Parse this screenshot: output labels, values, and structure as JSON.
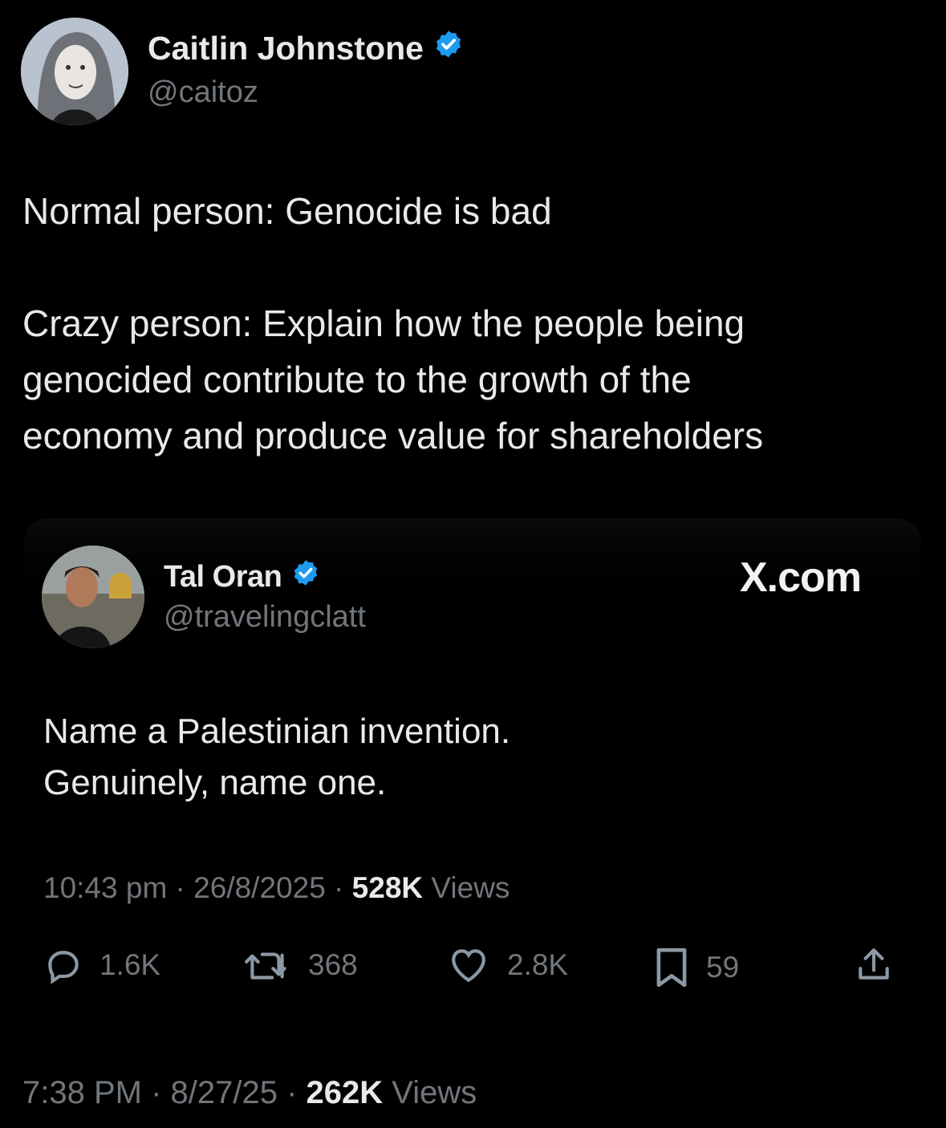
{
  "author": {
    "name": "Caitlin Johnstone",
    "handle": "@caitoz"
  },
  "tweet": {
    "line1": "Normal person: Genocide is bad",
    "para2_line1": "Crazy person: Explain how the people being",
    "para2_line2": "genocided contribute to the growth of the",
    "para2_line3": "economy and produce value for shareholders"
  },
  "quote": {
    "name": "Tal Oran",
    "handle": "@travelingclatt",
    "source": "X.com",
    "line1": "Name a Palestinian invention.",
    "line2": "Genuinely, name one.",
    "time": "10:43 pm",
    "date": "26/8/2025",
    "views": "528K",
    "views_label": "Views",
    "replies": "1.6K",
    "retweets": "368",
    "likes": "2.8K",
    "bookmarks": "59"
  },
  "meta": {
    "time": "7:38 PM",
    "date": "8/27/25",
    "views": "262K",
    "views_label": "Views"
  },
  "colors": {
    "background": "#000000",
    "text": "#e7e9ea",
    "secondary": "#71767b",
    "verified": "#1d9bf0"
  }
}
